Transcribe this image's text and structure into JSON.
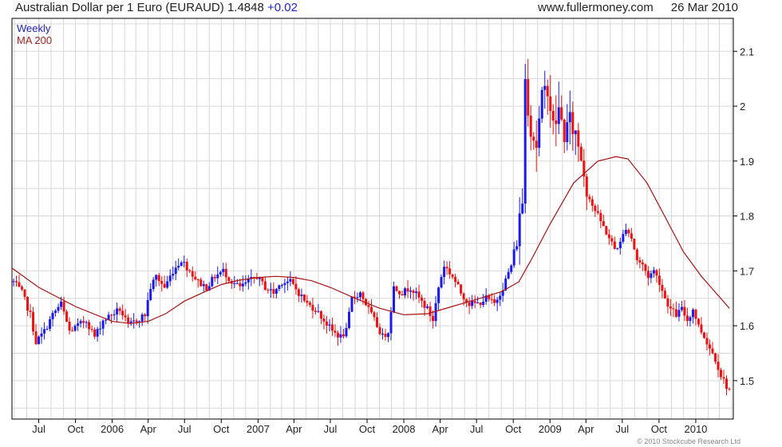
{
  "header": {
    "title": "Australian Dollar per 1 Euro (EURAUD)",
    "price": "1.4848",
    "change": "+0.02",
    "site": "www.fullermoney.com",
    "date": "26 Mar 2010"
  },
  "footer": {
    "copyright": "© 2010 Stockcube Research Ltd"
  },
  "colors": {
    "up": "#1a1aee",
    "down": "#ee1111",
    "ma": "#aa1111",
    "grid": "#d8d8d8",
    "axis": "#000000"
  },
  "chart_data": {
    "type": "candlestick",
    "interval": "weekly",
    "legend": [
      {
        "name": "Weekly",
        "color": "#2222bb"
      },
      {
        "name": "MA 200",
        "color": "#aa2222"
      }
    ],
    "legend_position": "top-left",
    "grid": true,
    "ylim": [
      1.43,
      2.16
    ],
    "yticks": [
      1.5,
      1.6,
      1.7,
      1.8,
      1.9,
      2.0,
      2.1
    ],
    "ytick_labels": [
      "1.5",
      "1.6",
      "1.7",
      "1.8",
      "1.9",
      "2",
      "2.1"
    ],
    "xlim": [
      "2005-04-25",
      "2010-04-05"
    ],
    "xticks": [
      {
        "date": "2005-07-01",
        "label": "Jul"
      },
      {
        "date": "2005-10-01",
        "label": "Oct"
      },
      {
        "date": "2006-01-01",
        "label": "2006"
      },
      {
        "date": "2006-04-01",
        "label": "Apr"
      },
      {
        "date": "2006-07-01",
        "label": "Jul"
      },
      {
        "date": "2006-10-01",
        "label": "Oct"
      },
      {
        "date": "2007-01-01",
        "label": "2007"
      },
      {
        "date": "2007-04-01",
        "label": "Apr"
      },
      {
        "date": "2007-07-01",
        "label": "Jul"
      },
      {
        "date": "2007-10-01",
        "label": "Oct"
      },
      {
        "date": "2008-01-01",
        "label": "2008"
      },
      {
        "date": "2008-04-01",
        "label": "Apr"
      },
      {
        "date": "2008-07-01",
        "label": "Jul"
      },
      {
        "date": "2008-10-01",
        "label": "Oct"
      },
      {
        "date": "2009-01-01",
        "label": "2009"
      },
      {
        "date": "2009-04-01",
        "label": "Apr"
      },
      {
        "date": "2009-07-01",
        "label": "Jul"
      },
      {
        "date": "2009-10-01",
        "label": "Oct"
      },
      {
        "date": "2010-01-01",
        "label": "2010"
      }
    ],
    "close_path": [
      [
        "2005-04-29",
        1.68
      ],
      [
        "2005-05-20",
        1.66
      ],
      [
        "2005-06-10",
        1.62
      ],
      [
        "2005-06-24",
        1.57
      ],
      [
        "2005-07-15",
        1.59
      ],
      [
        "2005-08-05",
        1.62
      ],
      [
        "2005-08-26",
        1.64
      ],
      [
        "2005-09-16",
        1.59
      ],
      [
        "2005-10-07",
        1.6
      ],
      [
        "2005-10-28",
        1.61
      ],
      [
        "2005-11-18",
        1.58
      ],
      [
        "2005-12-09",
        1.61
      ],
      [
        "2005-12-30",
        1.62
      ],
      [
        "2006-01-20",
        1.63
      ],
      [
        "2006-02-10",
        1.6
      ],
      [
        "2006-03-03",
        1.61
      ],
      [
        "2006-03-24",
        1.62
      ],
      [
        "2006-04-07",
        1.67
      ],
      [
        "2006-04-21",
        1.69
      ],
      [
        "2006-05-12",
        1.67
      ],
      [
        "2006-06-02",
        1.7
      ],
      [
        "2006-06-23",
        1.72
      ],
      [
        "2006-07-14",
        1.7
      ],
      [
        "2006-08-04",
        1.68
      ],
      [
        "2006-08-25",
        1.67
      ],
      [
        "2006-09-15",
        1.69
      ],
      [
        "2006-10-06",
        1.7
      ],
      [
        "2006-10-27",
        1.68
      ],
      [
        "2006-11-17",
        1.67
      ],
      [
        "2006-12-08",
        1.68
      ],
      [
        "2006-12-29",
        1.69
      ],
      [
        "2007-01-19",
        1.67
      ],
      [
        "2007-02-09",
        1.66
      ],
      [
        "2007-03-02",
        1.68
      ],
      [
        "2007-03-23",
        1.68
      ],
      [
        "2007-04-13",
        1.66
      ],
      [
        "2007-05-04",
        1.64
      ],
      [
        "2007-05-25",
        1.63
      ],
      [
        "2007-06-15",
        1.61
      ],
      [
        "2007-07-06",
        1.59
      ],
      [
        "2007-07-27",
        1.58
      ],
      [
        "2007-08-10",
        1.59
      ],
      [
        "2007-08-24",
        1.65
      ],
      [
        "2007-09-14",
        1.66
      ],
      [
        "2007-10-05",
        1.63
      ],
      [
        "2007-10-26",
        1.6
      ],
      [
        "2007-11-09",
        1.58
      ],
      [
        "2007-11-23",
        1.59
      ],
      [
        "2007-12-07",
        1.67
      ],
      [
        "2007-12-28",
        1.66
      ],
      [
        "2008-01-18",
        1.67
      ],
      [
        "2008-02-08",
        1.65
      ],
      [
        "2008-02-29",
        1.63
      ],
      [
        "2008-03-14",
        1.61
      ],
      [
        "2008-03-28",
        1.67
      ],
      [
        "2008-04-11",
        1.71
      ],
      [
        "2008-05-02",
        1.69
      ],
      [
        "2008-05-23",
        1.66
      ],
      [
        "2008-06-13",
        1.64
      ],
      [
        "2008-07-04",
        1.64
      ],
      [
        "2008-07-25",
        1.65
      ],
      [
        "2008-08-15",
        1.64
      ],
      [
        "2008-09-05",
        1.67
      ],
      [
        "2008-09-26",
        1.71
      ],
      [
        "2008-10-10",
        1.76
      ],
      [
        "2008-10-24",
        1.83
      ],
      [
        "2008-10-31",
        2.05
      ],
      [
        "2008-11-14",
        1.96
      ],
      [
        "2008-11-28",
        1.93
      ],
      [
        "2008-12-12",
        2.01
      ],
      [
        "2008-12-26",
        2.04
      ],
      [
        "2009-01-09",
        1.96
      ],
      [
        "2009-01-23",
        1.99
      ],
      [
        "2009-02-06",
        1.95
      ],
      [
        "2009-02-20",
        1.97
      ],
      [
        "2009-03-06",
        1.95
      ],
      [
        "2009-03-20",
        1.91
      ],
      [
        "2009-04-03",
        1.85
      ],
      [
        "2009-04-17",
        1.82
      ],
      [
        "2009-05-01",
        1.8
      ],
      [
        "2009-05-15",
        1.78
      ],
      [
        "2009-05-29",
        1.76
      ],
      [
        "2009-06-12",
        1.74
      ],
      [
        "2009-06-26",
        1.75
      ],
      [
        "2009-07-10",
        1.78
      ],
      [
        "2009-07-24",
        1.76
      ],
      [
        "2009-08-07",
        1.72
      ],
      [
        "2009-08-21",
        1.71
      ],
      [
        "2009-09-04",
        1.69
      ],
      [
        "2009-09-18",
        1.7
      ],
      [
        "2009-10-02",
        1.68
      ],
      [
        "2009-10-16",
        1.65
      ],
      [
        "2009-10-30",
        1.63
      ],
      [
        "2009-11-13",
        1.62
      ],
      [
        "2009-11-27",
        1.63
      ],
      [
        "2009-12-11",
        1.61
      ],
      [
        "2009-12-25",
        1.63
      ],
      [
        "2010-01-08",
        1.6
      ],
      [
        "2010-01-22",
        1.58
      ],
      [
        "2010-02-05",
        1.56
      ],
      [
        "2010-02-19",
        1.54
      ],
      [
        "2010-03-05",
        1.51
      ],
      [
        "2010-03-19",
        1.49
      ],
      [
        "2010-03-26",
        1.4848
      ]
    ],
    "series": [
      {
        "name": "MA 200",
        "points": [
          [
            "2005-04-25",
            1.705
          ],
          [
            "2005-07-01",
            1.67
          ],
          [
            "2005-10-01",
            1.635
          ],
          [
            "2006-01-01",
            1.608
          ],
          [
            "2006-02-15",
            1.604
          ],
          [
            "2006-04-01",
            1.608
          ],
          [
            "2006-05-15",
            1.622
          ],
          [
            "2006-07-01",
            1.645
          ],
          [
            "2006-08-15",
            1.66
          ],
          [
            "2006-10-01",
            1.675
          ],
          [
            "2006-11-15",
            1.683
          ],
          [
            "2007-01-01",
            1.688
          ],
          [
            "2007-02-15",
            1.69
          ],
          [
            "2007-04-01",
            1.688
          ],
          [
            "2007-05-15",
            1.682
          ],
          [
            "2007-07-01",
            1.67
          ],
          [
            "2007-09-01",
            1.65
          ],
          [
            "2007-11-01",
            1.632
          ],
          [
            "2008-01-01",
            1.62
          ],
          [
            "2008-03-01",
            1.622
          ],
          [
            "2008-05-01",
            1.635
          ],
          [
            "2008-07-01",
            1.648
          ],
          [
            "2008-09-01",
            1.662
          ],
          [
            "2008-10-15",
            1.68
          ],
          [
            "2008-11-15",
            1.72
          ],
          [
            "2009-01-01",
            1.785
          ],
          [
            "2009-03-01",
            1.86
          ],
          [
            "2009-05-01",
            1.9
          ],
          [
            "2009-06-15",
            1.908
          ],
          [
            "2009-07-15",
            1.904
          ],
          [
            "2009-09-01",
            1.86
          ],
          [
            "2009-10-15",
            1.8
          ],
          [
            "2009-12-01",
            1.735
          ],
          [
            "2010-01-15",
            1.69
          ],
          [
            "2010-03-26",
            1.632
          ]
        ]
      }
    ]
  }
}
